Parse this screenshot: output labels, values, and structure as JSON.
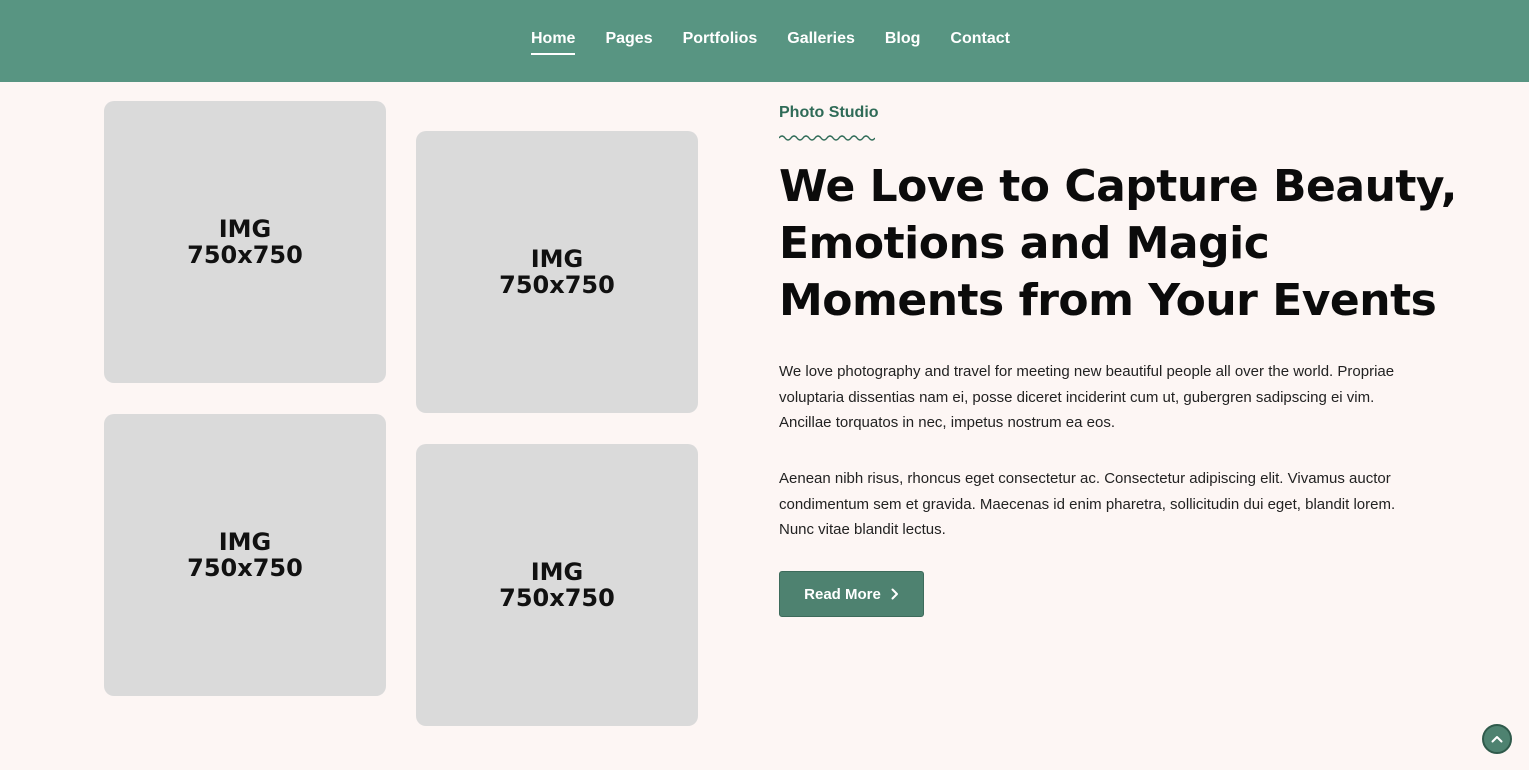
{
  "nav": {
    "items": [
      {
        "label": "Home",
        "active": true
      },
      {
        "label": "Pages",
        "active": false
      },
      {
        "label": "Portfolios",
        "active": false
      },
      {
        "label": "Galleries",
        "active": false
      },
      {
        "label": "Blog",
        "active": false
      },
      {
        "label": "Contact",
        "active": false
      }
    ]
  },
  "gallery": {
    "tiles": [
      {
        "placeholder": "IMG\n750x750"
      },
      {
        "placeholder": "IMG\n750x750"
      },
      {
        "placeholder": "IMG\n750x750"
      },
      {
        "placeholder": "IMG\n750x750"
      }
    ]
  },
  "hero": {
    "eyebrow": "Photo Studio",
    "headline": "We Love to Capture Beauty, Emotions and Magic Moments from Your Events",
    "paragraphs": [
      "We love photography and travel for meeting new beautiful people all over the world. Propriae voluptaria dissentias nam ei, posse diceret inciderint cum ut, gubergren sadipscing ei vim. Ancillae torquatos in nec, impetus nostrum ea eos.",
      "Aenean nibh risus, rhoncus eget consectetur ac. Consectetur adipiscing elit. Vivamus auctor condimentum sem et gravida. Maecenas id enim pharetra, sollicitudin dui eget, blandit lorem. Nunc vitae blandit lectus."
    ],
    "cta_label": "Read More",
    "cta_icon": "chevron-right-icon"
  },
  "scroll_top": {
    "icon": "chevron-up-icon"
  },
  "colors": {
    "header_bg": "#589582",
    "page_bg": "#fdf6f4",
    "accent": "#2f6b57",
    "button_bg": "#4e8270",
    "tile_bg": "#dadada"
  }
}
